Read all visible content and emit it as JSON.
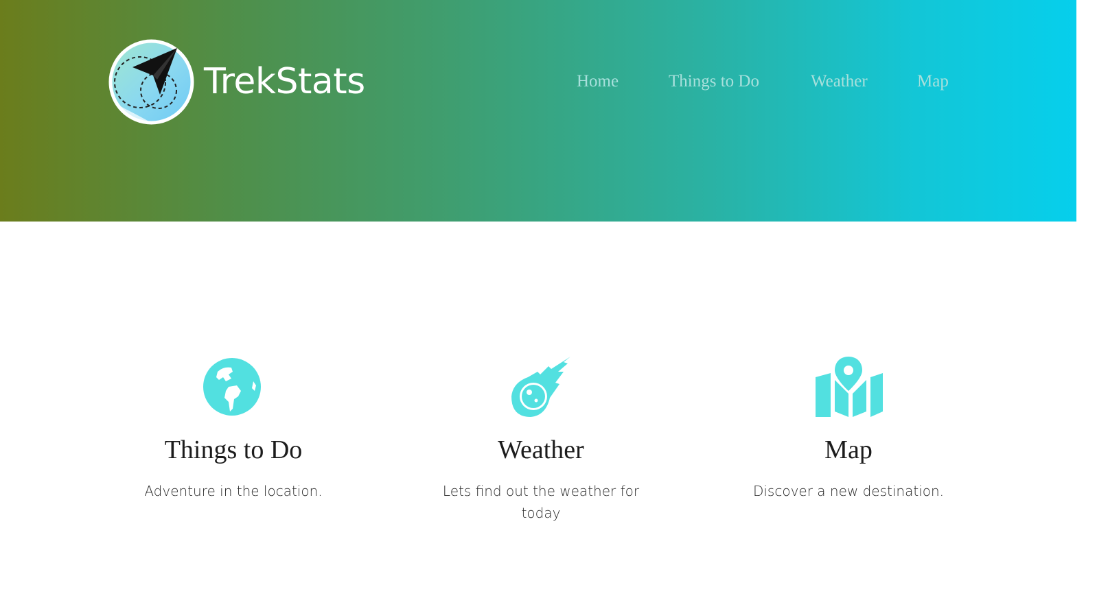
{
  "brand": {
    "name": "TrekStats",
    "logo_icon": "paper-plane-globe-icon"
  },
  "nav": {
    "items": [
      {
        "label": "Home"
      },
      {
        "label": "Things to Do"
      },
      {
        "label": "Weather"
      },
      {
        "label": "Map"
      }
    ]
  },
  "features": [
    {
      "icon": "globe-icon",
      "title": "Things to Do",
      "description": "Adventure in the location."
    },
    {
      "icon": "meteor-icon",
      "title": "Weather",
      "description": "Lets find out the weather for today"
    },
    {
      "icon": "map-marker-icon",
      "title": "Map",
      "description": "Discover a new destination."
    }
  ],
  "colors": {
    "header_gradient_start": "#6b7d1c",
    "header_gradient_end": "#06cfec",
    "icon_accent": "#52e0e0",
    "nav_text": "#a8e0dc",
    "brand_text": "#ffffff"
  }
}
